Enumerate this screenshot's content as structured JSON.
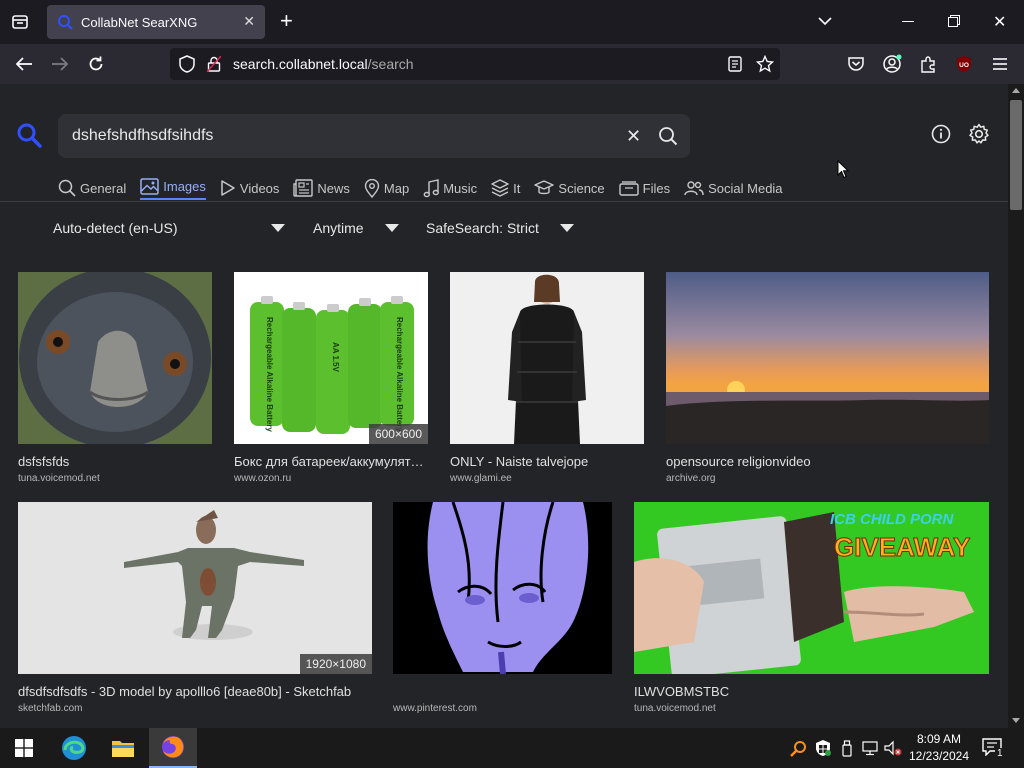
{
  "browser": {
    "tab_title": "CollabNet SearXNG",
    "url_host": "search.collabnet.local",
    "url_path": "/search"
  },
  "search": {
    "query": "dshefshdfhsdfsihdfs"
  },
  "categories": [
    {
      "label": "General",
      "icon": "search-icon",
      "active": false
    },
    {
      "label": "Images",
      "icon": "image-icon",
      "active": true
    },
    {
      "label": "Videos",
      "icon": "play-icon",
      "active": false
    },
    {
      "label": "News",
      "icon": "newspaper-icon",
      "active": false
    },
    {
      "label": "Map",
      "icon": "map-pin-icon",
      "active": false
    },
    {
      "label": "Music",
      "icon": "music-icon",
      "active": false
    },
    {
      "label": "It",
      "icon": "layers-icon",
      "active": false
    },
    {
      "label": "Science",
      "icon": "science-icon",
      "active": false
    },
    {
      "label": "Files",
      "icon": "files-icon",
      "active": false
    },
    {
      "label": "Social Media",
      "icon": "people-icon",
      "active": false
    }
  ],
  "filters": {
    "language": "Auto-detect (en-US)",
    "time": "Anytime",
    "safesearch": "SafeSearch: Strict"
  },
  "results": [
    {
      "title": "dsfsfsfds",
      "site": "tuna.voicemod.net",
      "badge": ""
    },
    {
      "title": "Бокс для батареек/аккумуляторов АА ...",
      "site": "www.ozon.ru",
      "badge": "600×600"
    },
    {
      "title": "ONLY - Naiste talvejope",
      "site": "www.glami.ee",
      "badge": ""
    },
    {
      "title": "opensource religionvideo",
      "site": "archive.org",
      "badge": ""
    },
    {
      "title": "dfsdfsdfsdfs - 3D model by apolllo6 [deae80b] - Sketchfab",
      "site": "sketchfab.com",
      "badge": "1920×1080"
    },
    {
      "title": "",
      "site": "www.pinterest.com",
      "badge": ""
    },
    {
      "title": "ILWVOBMSTBC",
      "site": "tuna.voicemod.net",
      "badge": ""
    }
  ],
  "image_text": {
    "battery_label": "Rechargeable Alkaline Battery",
    "battery_size": "AA 1.5V",
    "giveaway": "GIVEAWAY",
    "banner_top": "ICB CHILD PORN"
  },
  "taskbar": {
    "time": "8:09 AM",
    "date": "12/23/2024",
    "notif_count": "1"
  },
  "colors": {
    "accent": "#5f83f5",
    "page_bg": "#222428",
    "chrome_bg": "#2b2a33"
  }
}
